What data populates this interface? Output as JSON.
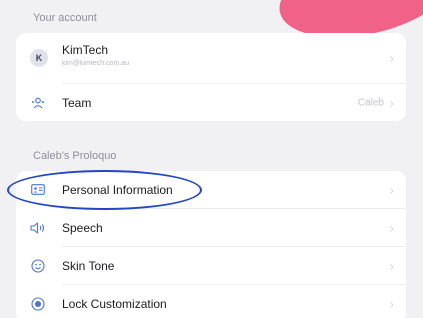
{
  "colors": {
    "accent_pink": "#f0527c",
    "icon_blue": "#4a74d6",
    "annotation_blue": "#2546c4"
  },
  "account_section": {
    "header": "Your account",
    "account": {
      "avatar_letter": "K",
      "name": "KimTech",
      "email": "kim@kimtech.com.au",
      "icon": "avatar-icon"
    },
    "team": {
      "label": "Team",
      "value": "Caleb",
      "icon": "team-icon"
    }
  },
  "proloquo_section": {
    "header": "Caleb's Proloquo",
    "items": [
      {
        "label": "Personal Information",
        "icon": "id-card-icon"
      },
      {
        "label": "Speech",
        "icon": "speaker-icon"
      },
      {
        "label": "Skin Tone",
        "icon": "smiley-icon"
      },
      {
        "label": "Lock Customization",
        "icon": "lock-icon"
      }
    ]
  }
}
